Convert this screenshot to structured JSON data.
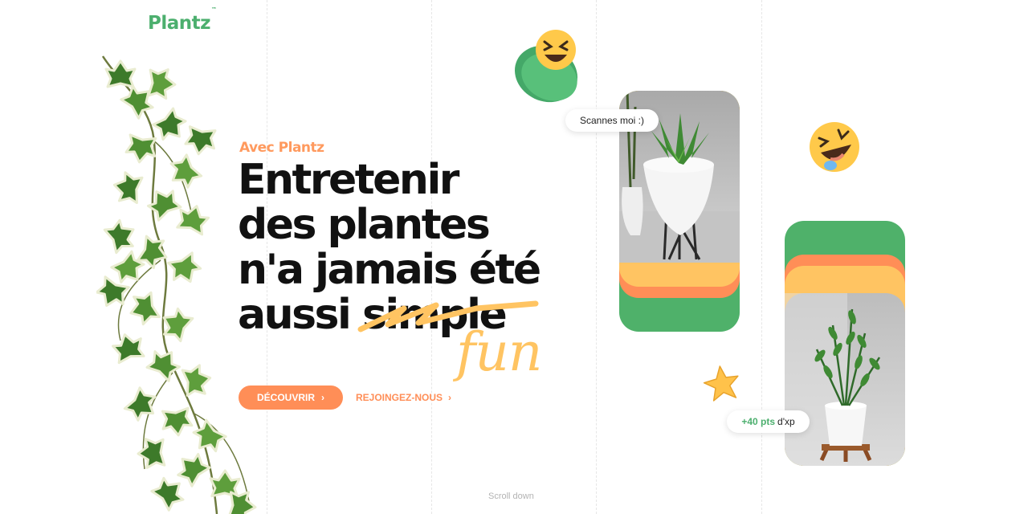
{
  "brand": {
    "name": "Plantz",
    "tm": "™"
  },
  "hero": {
    "eyebrow": "Avec Plantz",
    "line1": "Entretenir",
    "line2": "des plantes",
    "line3": "n'a jamais été",
    "line4_word": "aussi",
    "struck_word": "simple",
    "handwritten_word": "fun"
  },
  "buttons": {
    "discover_label": "DÉCOUVRIR",
    "join_label": "REJOINGEZ-NOUS"
  },
  "floating": {
    "scan_bubble": "Scannes moi :)",
    "points_value": "+40 pts",
    "points_suffix": "d'xp"
  },
  "footer": {
    "scroll_label": "Scroll down"
  },
  "colors": {
    "brand_green": "#4caf6e",
    "accent_orange": "#ff8e57",
    "accent_yellow": "#ffc462",
    "text_dark": "#111111"
  },
  "icons": {
    "emoji_top": "laughing-face-icon",
    "emoji_right": "rolling-laughing-face-icon",
    "star": "star-icon",
    "chevrons": "chevron-right-icon"
  }
}
